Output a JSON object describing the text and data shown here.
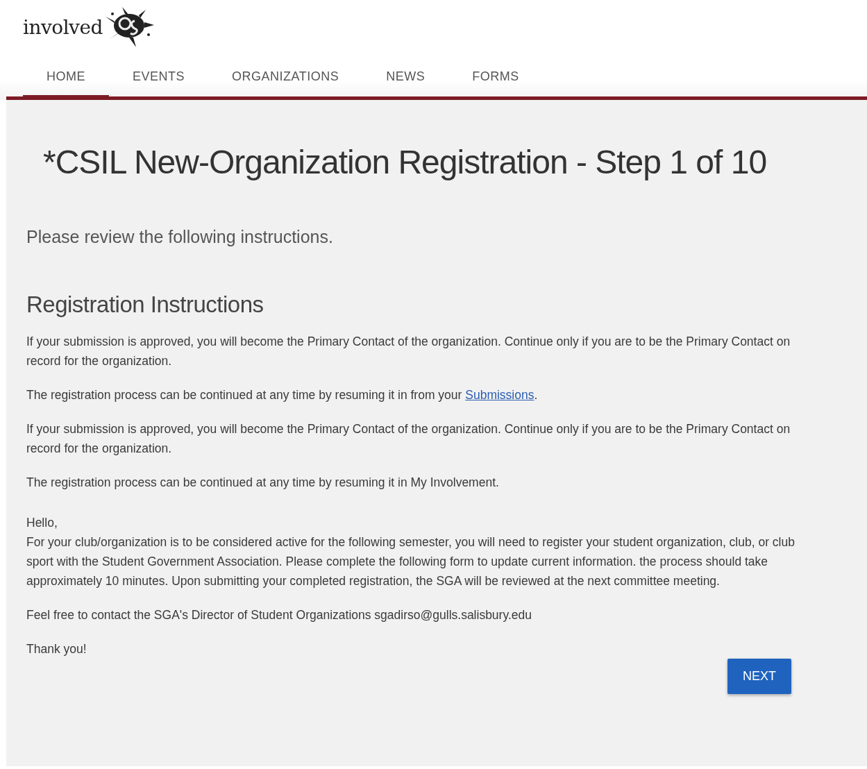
{
  "logo": {
    "text": "involved"
  },
  "nav": [
    {
      "label": "HOME",
      "selected": true
    },
    {
      "label": "EVENTS",
      "selected": false
    },
    {
      "label": "ORGANIZATIONS",
      "selected": false
    },
    {
      "label": "NEWS",
      "selected": false
    },
    {
      "label": "FORMS",
      "selected": false
    }
  ],
  "title": "*CSIL New-Organization Registration - Step 1 of 10",
  "subtitle": "Please review the following instructions.",
  "section_heading": "Registration Instructions",
  "paragraphs": [
    {
      "kind": "text",
      "text": "If your submission is approved, you will become the Primary Contact of the organization. Continue only if you are to be the Primary Contact on record for the organization."
    },
    {
      "kind": "link",
      "text": "The registration process can be continued at any time by resuming it in from your ",
      "link": "Submissions",
      "after": "."
    },
    {
      "kind": "text",
      "text": "If your submission is approved, you will become the Primary Contact of the organization. Continue only if you are to be the Primary Contact on record for the organization."
    },
    {
      "kind": "text",
      "text": "The registration process can be continued at any time by resuming it in My Involvement."
    }
  ],
  "message": {
    "greeting": "Hello,",
    "body": "For your club/organization is to be considered active for the following semester, you will need to register your student organization, club, or club sport with the Student Government Association. Please complete the following form to update current information. the process should take approximately 10 minutes. Upon submitting your completed registration, the SGA will be reviewed at the next committee meeting.",
    "contact": "Feel free to contact the SGA's Director of Student Organizations sgadirso@gulls.salisbury.edu",
    "closing": "Thank you!"
  },
  "next_button": "NEXT"
}
